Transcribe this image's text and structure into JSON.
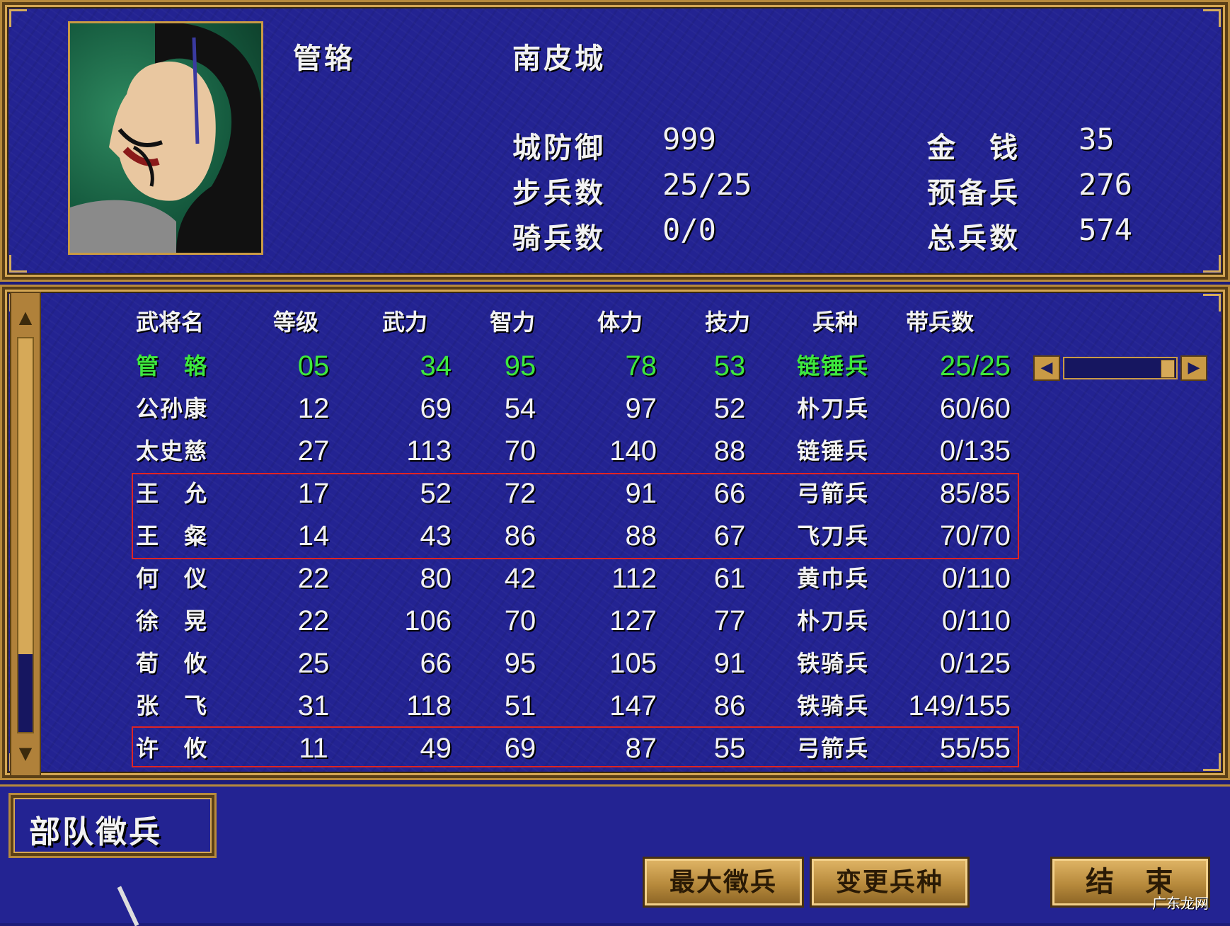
{
  "header": {
    "general_name": "管辂",
    "city_name": "南皮城",
    "stats_left": [
      {
        "label": "城防御",
        "value": "999"
      },
      {
        "label": "步兵数",
        "value": "25/25"
      },
      {
        "label": "骑兵数",
        "value": "0/0"
      }
    ],
    "stats_right": [
      {
        "label": "金　钱",
        "value": "35"
      },
      {
        "label": "预备兵",
        "value": "276"
      },
      {
        "label": "总兵数",
        "value": "574"
      }
    ]
  },
  "table": {
    "headers": [
      "武将名",
      "等级",
      "武力",
      "智力",
      "体力",
      "技力",
      "兵种",
      "带兵数"
    ],
    "rows": [
      {
        "name": "管　辂",
        "level": "05",
        "str": "34",
        "int": "95",
        "hp": "78",
        "skill": "53",
        "type": "链锤兵",
        "troops": "25/25"
      },
      {
        "name": "公孙康",
        "level": "12",
        "str": "69",
        "int": "54",
        "hp": "97",
        "skill": "52",
        "type": "朴刀兵",
        "troops": "60/60"
      },
      {
        "name": "太史慈",
        "level": "27",
        "str": "113",
        "int": "70",
        "hp": "140",
        "skill": "88",
        "type": "链锤兵",
        "troops": "0/135"
      },
      {
        "name": "王　允",
        "level": "17",
        "str": "52",
        "int": "72",
        "hp": "91",
        "skill": "66",
        "type": "弓箭兵",
        "troops": "85/85"
      },
      {
        "name": "王　粲",
        "level": "14",
        "str": "43",
        "int": "86",
        "hp": "88",
        "skill": "67",
        "type": "飞刀兵",
        "troops": "70/70"
      },
      {
        "name": "何　仪",
        "level": "22",
        "str": "80",
        "int": "42",
        "hp": "112",
        "skill": "61",
        "type": "黄巾兵",
        "troops": "0/110"
      },
      {
        "name": "徐　晃",
        "level": "22",
        "str": "106",
        "int": "70",
        "hp": "127",
        "skill": "77",
        "type": "朴刀兵",
        "troops": "0/110"
      },
      {
        "name": "荀　攸",
        "level": "25",
        "str": "66",
        "int": "95",
        "hp": "105",
        "skill": "91",
        "type": "铁骑兵",
        "troops": "0/125"
      },
      {
        "name": "张　飞",
        "level": "31",
        "str": "118",
        "int": "51",
        "hp": "147",
        "skill": "86",
        "type": "铁骑兵",
        "troops": "149/155"
      },
      {
        "name": "许　攸",
        "level": "11",
        "str": "49",
        "int": "69",
        "hp": "87",
        "skill": "55",
        "type": "弓箭兵",
        "troops": "55/55"
      }
    ]
  },
  "footer": {
    "section_title": "部队徵兵",
    "buttons": [
      "最大徵兵",
      "变更兵种",
      "结　束"
    ]
  },
  "watermark": "广东龙网",
  "colors": {
    "selected_row": "#3ee83e",
    "highlight_border": "#e02424",
    "panel_bg": "#232392",
    "gold_border": "#b78a3c"
  }
}
